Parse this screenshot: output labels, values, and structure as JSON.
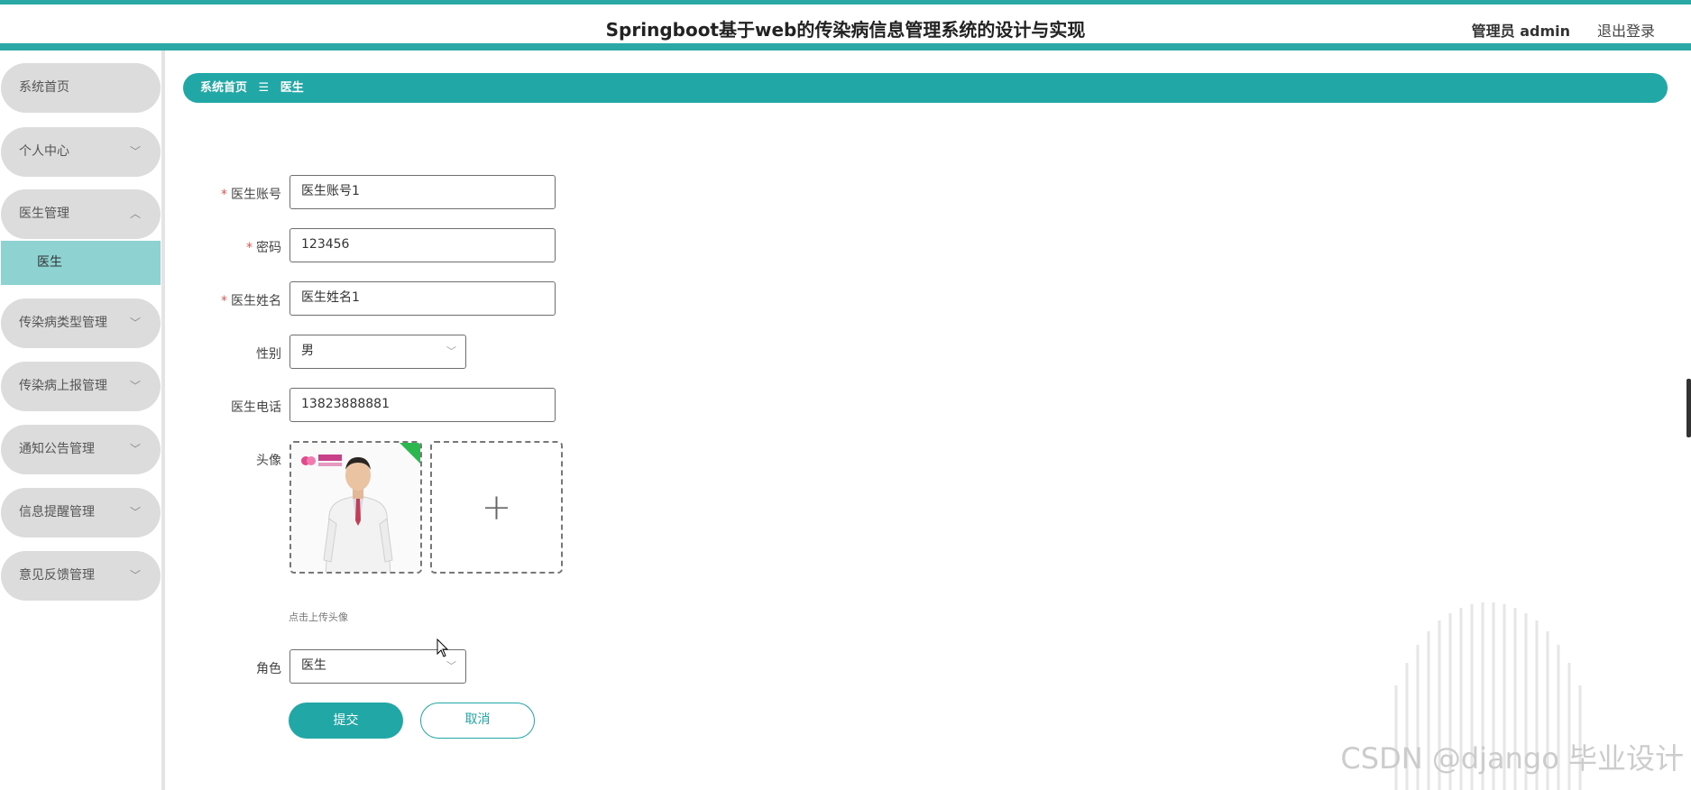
{
  "header": {
    "title": "Springboot基于web的传染病信息管理系统的设计与实现",
    "user_label": "管理员 admin",
    "logout_label": "退出登录"
  },
  "sidebar": {
    "items": [
      {
        "label": "系统首页"
      },
      {
        "label": "个人中心"
      },
      {
        "label": "医生管理"
      },
      {
        "label": "传染病类型管理"
      },
      {
        "label": "传染病上报管理"
      },
      {
        "label": "通知公告管理"
      },
      {
        "label": "信息提醒管理"
      },
      {
        "label": "意见反馈管理"
      }
    ],
    "active_sub": "医生"
  },
  "breadcrumb": {
    "home": "系统首页",
    "separator": "☰",
    "current": "医生"
  },
  "form": {
    "account_label": "医生账号",
    "account_value": "医生账号1",
    "password_label": "密码",
    "password_value": "123456",
    "name_label": "医生姓名",
    "name_value": "医生姓名1",
    "gender_label": "性别",
    "gender_value": "男",
    "phone_label": "医生电话",
    "phone_value": "13823888881",
    "avatar_label": "头像",
    "avatar_hint": "点击上传头像",
    "role_label": "角色",
    "role_value": "医生",
    "submit_label": "提交",
    "cancel_label": "取消",
    "required_mark": "*"
  },
  "watermark": "CSDN @django 毕业设计",
  "colors": {
    "primary": "#20a7a6",
    "menu_bg": "#dddcdd",
    "submenu_active": "#8fd2d2"
  }
}
